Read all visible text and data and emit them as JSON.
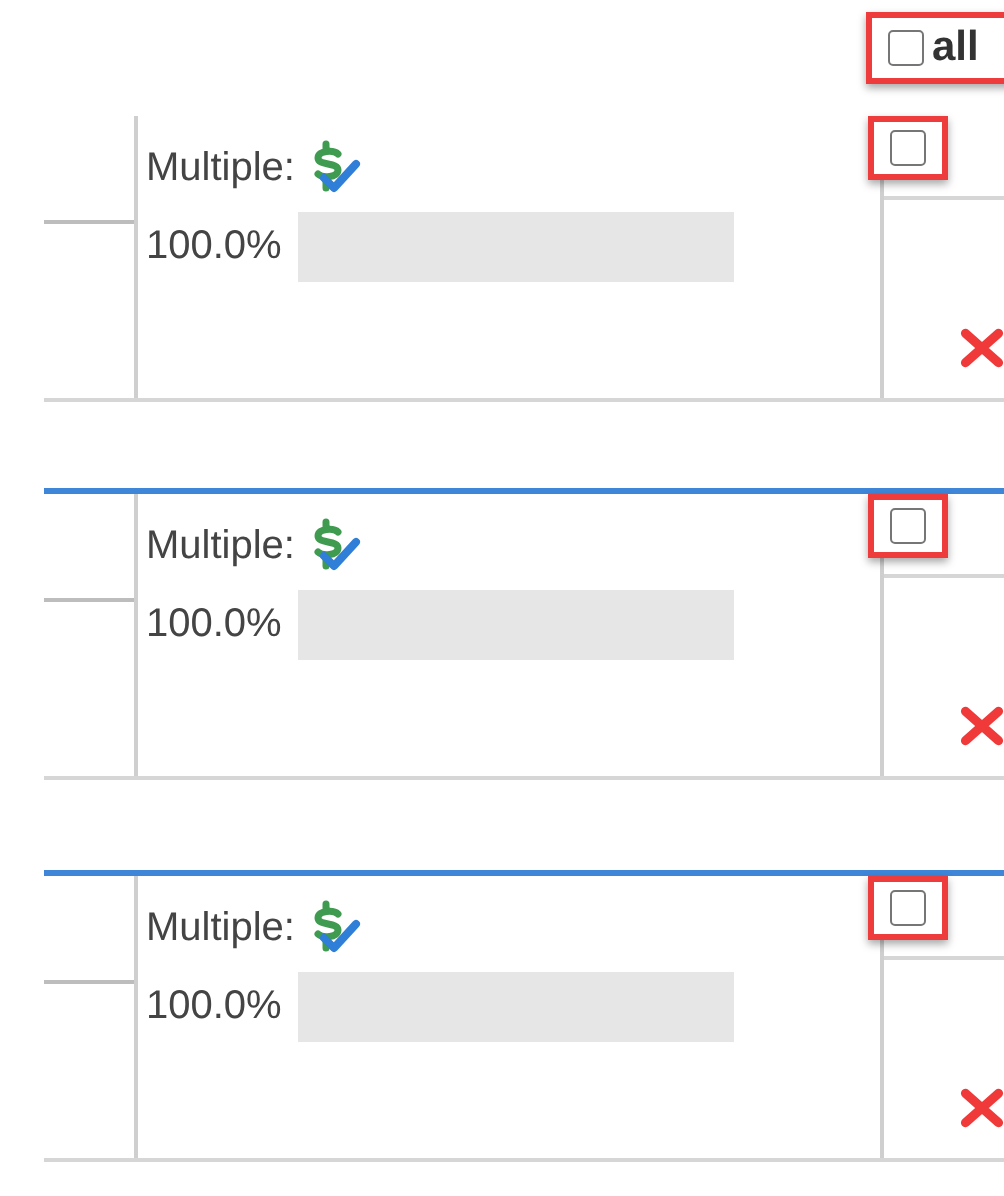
{
  "select_all": {
    "label": "all",
    "checked": false
  },
  "rows": [
    {
      "accent_line": false,
      "label": "Multiple:",
      "percent": "100.0%",
      "checked": false
    },
    {
      "accent_line": true,
      "label": "Multiple:",
      "percent": "100.0%",
      "checked": false
    },
    {
      "accent_line": true,
      "label": "Multiple:",
      "percent": "100.0%",
      "checked": false
    }
  ]
}
